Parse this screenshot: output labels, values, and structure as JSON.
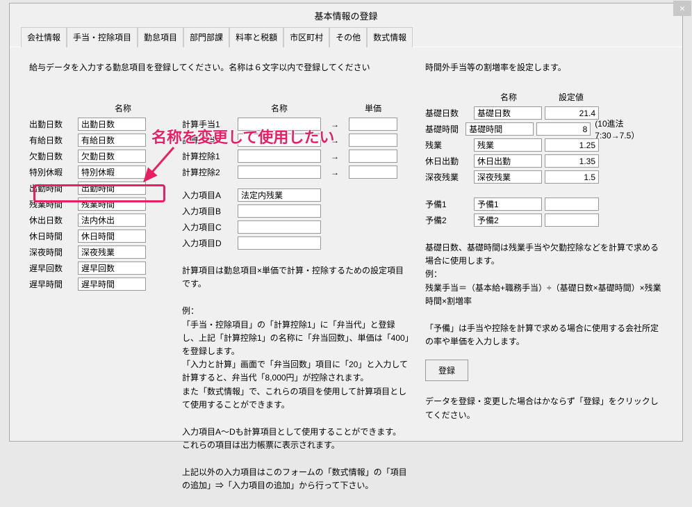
{
  "window": {
    "title": "基本情報の登録"
  },
  "tabs": [
    {
      "label": "会社情報"
    },
    {
      "label": "手当・控除項目"
    },
    {
      "label": "勤怠項目"
    },
    {
      "label": "部門部課"
    },
    {
      "label": "料率と税額"
    },
    {
      "label": "市区町村"
    },
    {
      "label": "その他"
    },
    {
      "label": "数式情報"
    }
  ],
  "left": {
    "instruction": "給与データを入力する勤怠項目を登録してください。名称は６文字以内で登録してください",
    "header": "名称",
    "items": [
      {
        "label": "出勤日数",
        "value": "出勤日数"
      },
      {
        "label": "有給日数",
        "value": "有給日数"
      },
      {
        "label": "欠勤日数",
        "value": "欠勤日数"
      },
      {
        "label": "特別休暇",
        "value": "特別休暇"
      },
      {
        "label": "出勤時間",
        "value": "出勤時間"
      },
      {
        "label": "残業時間",
        "value": "残業時間"
      },
      {
        "label": "休出日数",
        "value": "法内休出"
      },
      {
        "label": "休日時間",
        "value": "休日時間"
      },
      {
        "label": "深夜時間",
        "value": "深夜残業"
      },
      {
        "label": "遅早回数",
        "value": "遅早回数"
      },
      {
        "label": "遅早時間",
        "value": "遅早時間"
      }
    ]
  },
  "mid": {
    "header_name": "名称",
    "header_unit": "単価",
    "calc_rows": [
      {
        "label": "計算手当1",
        "value": "",
        "unit": ""
      },
      {
        "label": "計算手当2",
        "value": "",
        "unit": ""
      },
      {
        "label": "計算控除1",
        "value": "",
        "unit": ""
      },
      {
        "label": "計算控除2",
        "value": "",
        "unit": ""
      }
    ],
    "input_rows": [
      {
        "label": "入力項目A",
        "value": "法定内残業"
      },
      {
        "label": "入力項目B",
        "value": ""
      },
      {
        "label": "入力項目C",
        "value": ""
      },
      {
        "label": "入力項目D",
        "value": ""
      }
    ],
    "help1": "計算項目は勤怠項目×単価で計算・控除するための設定項目です。",
    "help2_l1": "例：",
    "help2_l2": "「手当・控除項目」の「計算控除1」に「弁当代」と登録し、上記「計算控除1」の名称に「弁当回数」、単価は「400」を登録します。",
    "help2_l3": "「入力と計算」画面で「弁当回数」項目に「20」と入力して計算すると、弁当代「8,000円」が控除されます。",
    "help2_l4": "また「数式情報」で、これらの項目を使用して計算項目として使用することができます。",
    "help3_l1": "入力項目A～Dも計算項目として使用することができます。",
    "help3_l2": "これらの項目は出力帳票に表示されます。",
    "help4": "上記以外の入力項目はこのフォームの「数式情報」の「項目の追加」⇒「入力項目の追加」から行って下さい。"
  },
  "right": {
    "instruction": "時間外手当等の割増率を設定します。",
    "header_name": "名称",
    "header_val": "設定値",
    "items": [
      {
        "label": "基礎日数",
        "name": "基礎日数",
        "value": "21.4",
        "note": ""
      },
      {
        "label": "基礎時間",
        "name": "基礎時間",
        "value": "8",
        "note": "(10進法　7:30→7.5）"
      },
      {
        "label": "残業",
        "name": "残業",
        "value": "1.25",
        "note": ""
      },
      {
        "label": "休日出勤",
        "name": "休日出勤",
        "value": "1.35",
        "note": ""
      },
      {
        "label": "深夜残業",
        "name": "深夜残業",
        "value": "1.5",
        "note": ""
      }
    ],
    "yobi": [
      {
        "label": "予備1",
        "name": "予備1",
        "value": ""
      },
      {
        "label": "予備2",
        "name": "予備2",
        "value": ""
      }
    ],
    "help1_l1": "基礎日数、基礎時間は残業手当や欠勤控除などを計算で求める場合に使用します。",
    "help1_l2": "例：",
    "help1_l3": "残業手当＝（基本給+職務手当）÷（基礎日数×基礎時間）×残業時間×割増率",
    "help2": "「予備」は手当や控除を計算で求める場合に使用する会社所定の率や単価を入力します。",
    "register_label": "登録",
    "help3": "データを登録・変更した場合はかならず「登録」をクリックしてください。"
  },
  "annotation": {
    "text": "名称を変更して使用したい"
  }
}
